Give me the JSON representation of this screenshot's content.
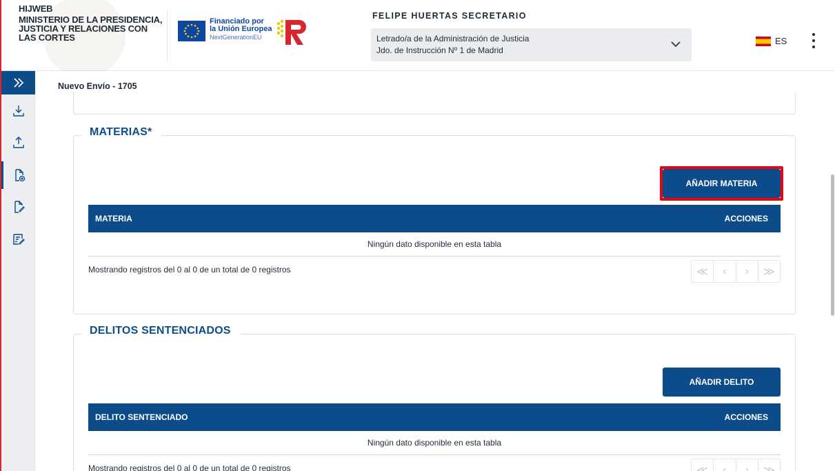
{
  "header": {
    "app_name": "HIJWEB",
    "ministry": "MINISTERIO DE LA PRESIDENCIA, JUSTICIA Y RELACIONES CON LAS CORTES",
    "eu_line1": "Financiado por",
    "eu_line2": "la Unión Europea",
    "eu_line3": "NextGenerationEU",
    "user_name": "FELIPE HUERTAS SECRETARIO",
    "role_line1": "Letrado/a de la Administración de Justicia",
    "role_line2": "Jdo. de Instrucción Nº 1 de Madrid",
    "language": "ES"
  },
  "sidebar": {
    "items": [
      {
        "icon": "download-tray-icon"
      },
      {
        "icon": "upload-tray-icon"
      },
      {
        "icon": "new-document-icon",
        "active": true
      },
      {
        "icon": "edit-document-icon"
      },
      {
        "icon": "signed-form-icon"
      }
    ]
  },
  "main": {
    "page_title": "Nuevo Envío - 1705",
    "materias": {
      "legend": "MATERIAS*",
      "add_button": "AÑADIR MATERIA",
      "col_main": "MATERIA",
      "col_actions": "ACCIONES",
      "empty": "Ningún dato disponible en esta tabla",
      "info": "Mostrando registros del 0 al 0 de un total de 0 registros"
    },
    "delitos": {
      "legend": "DELITOS SENTENCIADOS",
      "add_button": "AÑADIR DELITO",
      "col_main": "DELITO SENTENCIADO",
      "col_actions": "ACCIONES",
      "empty": "Ningún dato disponible en esta tabla",
      "info": "Mostrando registros del 0 al 0 de un total de 0 registros"
    },
    "pager": {
      "first": "≪",
      "prev": "‹",
      "next": "›",
      "last": "≫"
    }
  },
  "colors": {
    "primary": "#0d4c8b",
    "highlight": "#e40613",
    "accent_left": "#d8262c"
  }
}
